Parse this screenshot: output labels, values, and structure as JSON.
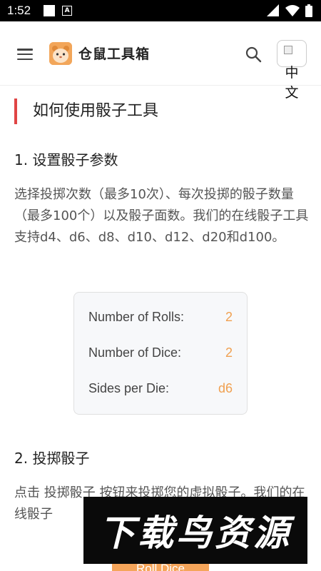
{
  "status_bar": {
    "time": "1:52",
    "notification_icon": "a-icon"
  },
  "header": {
    "app_title": "仓鼠工具箱",
    "logo_icon": "hamster-icon",
    "language_label": "中文"
  },
  "article": {
    "section_title": "如何使用骰子工具",
    "step1_title": "1. 设置骰子参数",
    "step1_text": "选择投掷次数（最多10次）、每次投掷的骰子数量（最多100个）以及骰子面数。我们的在线骰子工具支持d4、d6、d8、d10、d12、d20和d100。",
    "settings": [
      {
        "label": "Number of Rolls:",
        "value": "2"
      },
      {
        "label": "Number of Dice:",
        "value": "2"
      },
      {
        "label": "Sides per Die:",
        "value": "d6"
      }
    ],
    "step2_title": "2. 投掷骰子",
    "step2_text": "点击 投掷骰子 按钮来投掷您的虚拟骰子。我们的在线骰子",
    "roll_button_label": "Roll Dice"
  },
  "watermark": "下载鸟资源",
  "colors": {
    "accent": "#f0a050",
    "section_bar": "#e04545",
    "button": "#f5a55a"
  }
}
